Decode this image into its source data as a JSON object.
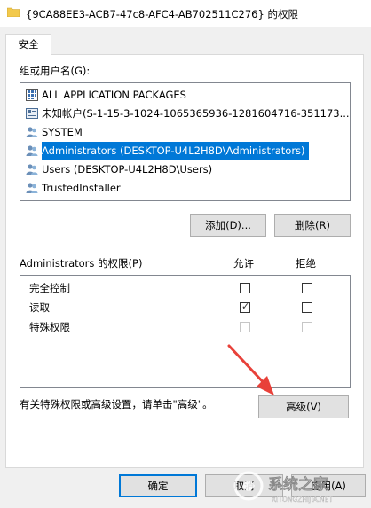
{
  "window": {
    "title": "{9CA88EE3-ACB7-47c8-AFC4-AB702511C276} 的权限"
  },
  "tabs": [
    {
      "label": "安全"
    }
  ],
  "groups": {
    "label": "组或用户名(G):",
    "items": [
      {
        "label": "ALL APPLICATION PACKAGES",
        "icon": "app-packages-icon"
      },
      {
        "label": "未知帐户(S-1-15-3-1024-1065365936-1281604716-351173...",
        "icon": "unknown-account-icon"
      },
      {
        "label": "SYSTEM",
        "icon": "users-icon"
      },
      {
        "label": "Administrators (DESKTOP-U4L2H8D\\Administrators)",
        "icon": "users-icon",
        "selected": true
      },
      {
        "label": "Users (DESKTOP-U4L2H8D\\Users)",
        "icon": "users-icon"
      },
      {
        "label": "TrustedInstaller",
        "icon": "users-icon"
      }
    ]
  },
  "buttons": {
    "add": "添加(D)...",
    "remove": "删除(R)",
    "advanced": "高级(V)",
    "ok": "确定",
    "cancel": "取消",
    "apply": "应用(A)"
  },
  "permissions": {
    "label": "Administrators 的权限(P)",
    "allow_header": "允许",
    "deny_header": "拒绝",
    "rows": [
      {
        "name": "完全控制",
        "allow": false,
        "deny": false,
        "disabled": false
      },
      {
        "name": "读取",
        "allow": true,
        "deny": false,
        "disabled": false
      },
      {
        "name": "特殊权限",
        "allow": false,
        "deny": false,
        "disabled": true
      }
    ]
  },
  "advanced_hint": "有关特殊权限或高级设置，请单击\"高级\"。",
  "watermark": {
    "brand": "系统之家",
    "url": "XITONGZHIJIA.NET"
  },
  "colors": {
    "selection": "#0078d7",
    "arrow": "#e8413a"
  }
}
